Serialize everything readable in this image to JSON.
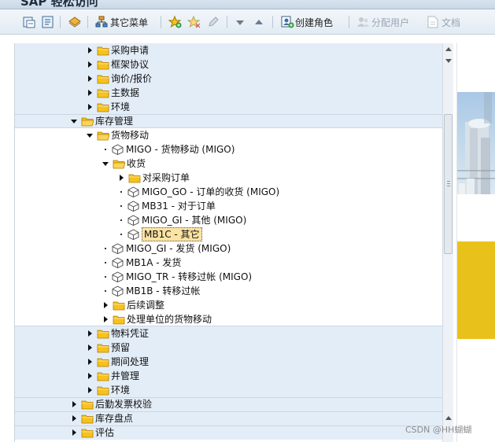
{
  "window": {
    "title": "SAP 轻松访问"
  },
  "toolbar": {
    "other_menu": "其它菜单",
    "create_role": "创建角色",
    "assign_user": "分配用户",
    "documentation": "文档"
  },
  "tree": [
    {
      "label": "采购申请",
      "level": 4,
      "type": "folder",
      "state": "collapsed",
      "band": true
    },
    {
      "label": "框架协议",
      "level": 4,
      "type": "folder",
      "state": "collapsed",
      "band": true
    },
    {
      "label": "询价/报价",
      "level": 4,
      "type": "folder",
      "state": "collapsed",
      "band": true
    },
    {
      "label": "主数据",
      "level": 4,
      "type": "folder",
      "state": "collapsed",
      "band": true
    },
    {
      "label": "环境",
      "level": 4,
      "type": "folder",
      "state": "collapsed",
      "band": true
    },
    {
      "label": "库存管理",
      "level": 3,
      "type": "folder",
      "state": "expanded",
      "band": true
    },
    {
      "label": "货物移动",
      "level": 4,
      "type": "folder",
      "state": "expanded",
      "band": false
    },
    {
      "label": "MIGO - 货物移动 (MIGO)",
      "level": 5,
      "type": "transaction",
      "band": false
    },
    {
      "label": "收货",
      "level": 5,
      "type": "folder",
      "state": "expanded",
      "band": false
    },
    {
      "label": "对采购订单",
      "level": 6,
      "type": "folder",
      "state": "collapsed",
      "band": false
    },
    {
      "label": "MIGO_GO - 订单的收货 (MIGO)",
      "level": 6,
      "type": "transaction",
      "band": false
    },
    {
      "label": "MB31 - 对于订单",
      "level": 6,
      "type": "transaction",
      "band": false
    },
    {
      "label": "MIGO_GI - 其他 (MIGO)",
      "level": 6,
      "type": "transaction",
      "band": false
    },
    {
      "label": "MB1C - 其它",
      "level": 6,
      "type": "transaction",
      "band": false,
      "selected": true
    },
    {
      "label": "MIGO_GI - 发货 (MIGO)",
      "level": 5,
      "type": "transaction",
      "band": false
    },
    {
      "label": "MB1A - 发货",
      "level": 5,
      "type": "transaction",
      "band": false
    },
    {
      "label": "MIGO_TR - 转移过帐 (MIGO)",
      "level": 5,
      "type": "transaction",
      "band": false
    },
    {
      "label": "MB1B - 转移过帐",
      "level": 5,
      "type": "transaction",
      "band": false
    },
    {
      "label": "后续调整",
      "level": 5,
      "type": "folder",
      "state": "collapsed",
      "band": false
    },
    {
      "label": "处理单位的货物移动",
      "level": 5,
      "type": "folder",
      "state": "collapsed",
      "band": false
    },
    {
      "label": "物料凭证",
      "level": 4,
      "type": "folder",
      "state": "collapsed",
      "band": true
    },
    {
      "label": "预留",
      "level": 4,
      "type": "folder",
      "state": "collapsed",
      "band": true
    },
    {
      "label": "期间处理",
      "level": 4,
      "type": "folder",
      "state": "collapsed",
      "band": true
    },
    {
      "label": "井管理",
      "level": 4,
      "type": "folder",
      "state": "collapsed",
      "band": true
    },
    {
      "label": "环境",
      "level": 4,
      "type": "folder",
      "state": "collapsed",
      "band": true
    },
    {
      "label": "后勤发票校验",
      "level": 3,
      "type": "folder",
      "state": "collapsed",
      "band": true
    },
    {
      "label": "库存盘点",
      "level": 3,
      "type": "folder",
      "state": "collapsed",
      "band": true
    },
    {
      "label": "评估",
      "level": 3,
      "type": "folder",
      "state": "collapsed",
      "band": true
    }
  ],
  "watermark": "CSDN @HH蝴蝴",
  "colors": {
    "folder": "#f7c21c",
    "folder_stroke": "#b07e00",
    "band": "#e3edf7",
    "selection": "#fbe3a3",
    "accent_yellow": "#e8c21a"
  },
  "icons": {
    "folder": "folder-icon",
    "transaction": "transaction-cube-icon"
  }
}
